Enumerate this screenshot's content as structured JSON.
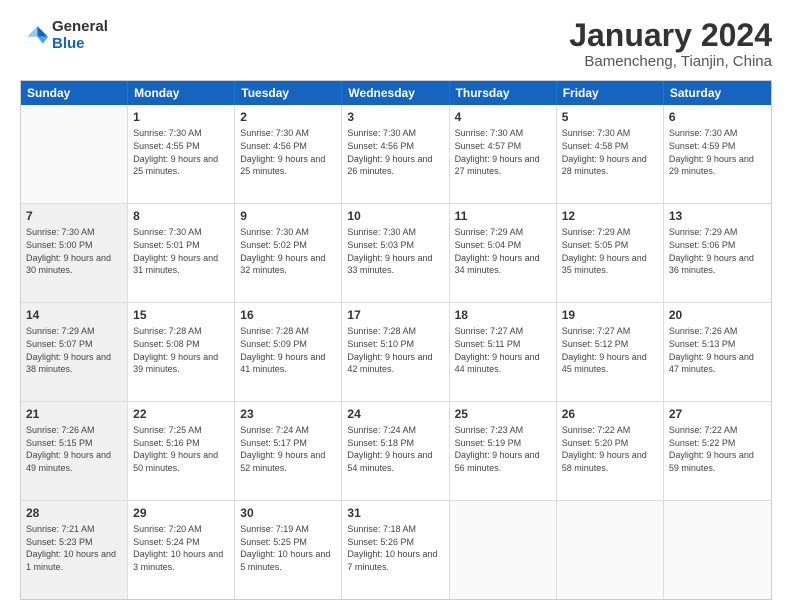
{
  "logo": {
    "line1": "General",
    "line2": "Blue"
  },
  "title": "January 2024",
  "location": "Bamencheng, Tianjin, China",
  "header_days": [
    "Sunday",
    "Monday",
    "Tuesday",
    "Wednesday",
    "Thursday",
    "Friday",
    "Saturday"
  ],
  "weeks": [
    [
      {
        "day": "",
        "sunrise": "",
        "sunset": "",
        "daylight": "",
        "shaded": true
      },
      {
        "day": "1",
        "sunrise": "Sunrise: 7:30 AM",
        "sunset": "Sunset: 4:55 PM",
        "daylight": "Daylight: 9 hours and 25 minutes.",
        "shaded": false
      },
      {
        "day": "2",
        "sunrise": "Sunrise: 7:30 AM",
        "sunset": "Sunset: 4:56 PM",
        "daylight": "Daylight: 9 hours and 25 minutes.",
        "shaded": false
      },
      {
        "day": "3",
        "sunrise": "Sunrise: 7:30 AM",
        "sunset": "Sunset: 4:56 PM",
        "daylight": "Daylight: 9 hours and 26 minutes.",
        "shaded": false
      },
      {
        "day": "4",
        "sunrise": "Sunrise: 7:30 AM",
        "sunset": "Sunset: 4:57 PM",
        "daylight": "Daylight: 9 hours and 27 minutes.",
        "shaded": false
      },
      {
        "day": "5",
        "sunrise": "Sunrise: 7:30 AM",
        "sunset": "Sunset: 4:58 PM",
        "daylight": "Daylight: 9 hours and 28 minutes.",
        "shaded": false
      },
      {
        "day": "6",
        "sunrise": "Sunrise: 7:30 AM",
        "sunset": "Sunset: 4:59 PM",
        "daylight": "Daylight: 9 hours and 29 minutes.",
        "shaded": false
      }
    ],
    [
      {
        "day": "7",
        "sunrise": "Sunrise: 7:30 AM",
        "sunset": "Sunset: 5:00 PM",
        "daylight": "Daylight: 9 hours and 30 minutes.",
        "shaded": true
      },
      {
        "day": "8",
        "sunrise": "Sunrise: 7:30 AM",
        "sunset": "Sunset: 5:01 PM",
        "daylight": "Daylight: 9 hours and 31 minutes.",
        "shaded": false
      },
      {
        "day": "9",
        "sunrise": "Sunrise: 7:30 AM",
        "sunset": "Sunset: 5:02 PM",
        "daylight": "Daylight: 9 hours and 32 minutes.",
        "shaded": false
      },
      {
        "day": "10",
        "sunrise": "Sunrise: 7:30 AM",
        "sunset": "Sunset: 5:03 PM",
        "daylight": "Daylight: 9 hours and 33 minutes.",
        "shaded": false
      },
      {
        "day": "11",
        "sunrise": "Sunrise: 7:29 AM",
        "sunset": "Sunset: 5:04 PM",
        "daylight": "Daylight: 9 hours and 34 minutes.",
        "shaded": false
      },
      {
        "day": "12",
        "sunrise": "Sunrise: 7:29 AM",
        "sunset": "Sunset: 5:05 PM",
        "daylight": "Daylight: 9 hours and 35 minutes.",
        "shaded": false
      },
      {
        "day": "13",
        "sunrise": "Sunrise: 7:29 AM",
        "sunset": "Sunset: 5:06 PM",
        "daylight": "Daylight: 9 hours and 36 minutes.",
        "shaded": false
      }
    ],
    [
      {
        "day": "14",
        "sunrise": "Sunrise: 7:29 AM",
        "sunset": "Sunset: 5:07 PM",
        "daylight": "Daylight: 9 hours and 38 minutes.",
        "shaded": true
      },
      {
        "day": "15",
        "sunrise": "Sunrise: 7:28 AM",
        "sunset": "Sunset: 5:08 PM",
        "daylight": "Daylight: 9 hours and 39 minutes.",
        "shaded": false
      },
      {
        "day": "16",
        "sunrise": "Sunrise: 7:28 AM",
        "sunset": "Sunset: 5:09 PM",
        "daylight": "Daylight: 9 hours and 41 minutes.",
        "shaded": false
      },
      {
        "day": "17",
        "sunrise": "Sunrise: 7:28 AM",
        "sunset": "Sunset: 5:10 PM",
        "daylight": "Daylight: 9 hours and 42 minutes.",
        "shaded": false
      },
      {
        "day": "18",
        "sunrise": "Sunrise: 7:27 AM",
        "sunset": "Sunset: 5:11 PM",
        "daylight": "Daylight: 9 hours and 44 minutes.",
        "shaded": false
      },
      {
        "day": "19",
        "sunrise": "Sunrise: 7:27 AM",
        "sunset": "Sunset: 5:12 PM",
        "daylight": "Daylight: 9 hours and 45 minutes.",
        "shaded": false
      },
      {
        "day": "20",
        "sunrise": "Sunrise: 7:26 AM",
        "sunset": "Sunset: 5:13 PM",
        "daylight": "Daylight: 9 hours and 47 minutes.",
        "shaded": false
      }
    ],
    [
      {
        "day": "21",
        "sunrise": "Sunrise: 7:26 AM",
        "sunset": "Sunset: 5:15 PM",
        "daylight": "Daylight: 9 hours and 49 minutes.",
        "shaded": true
      },
      {
        "day": "22",
        "sunrise": "Sunrise: 7:25 AM",
        "sunset": "Sunset: 5:16 PM",
        "daylight": "Daylight: 9 hours and 50 minutes.",
        "shaded": false
      },
      {
        "day": "23",
        "sunrise": "Sunrise: 7:24 AM",
        "sunset": "Sunset: 5:17 PM",
        "daylight": "Daylight: 9 hours and 52 minutes.",
        "shaded": false
      },
      {
        "day": "24",
        "sunrise": "Sunrise: 7:24 AM",
        "sunset": "Sunset: 5:18 PM",
        "daylight": "Daylight: 9 hours and 54 minutes.",
        "shaded": false
      },
      {
        "day": "25",
        "sunrise": "Sunrise: 7:23 AM",
        "sunset": "Sunset: 5:19 PM",
        "daylight": "Daylight: 9 hours and 56 minutes.",
        "shaded": false
      },
      {
        "day": "26",
        "sunrise": "Sunrise: 7:22 AM",
        "sunset": "Sunset: 5:20 PM",
        "daylight": "Daylight: 9 hours and 58 minutes.",
        "shaded": false
      },
      {
        "day": "27",
        "sunrise": "Sunrise: 7:22 AM",
        "sunset": "Sunset: 5:22 PM",
        "daylight": "Daylight: 9 hours and 59 minutes.",
        "shaded": false
      }
    ],
    [
      {
        "day": "28",
        "sunrise": "Sunrise: 7:21 AM",
        "sunset": "Sunset: 5:23 PM",
        "daylight": "Daylight: 10 hours and 1 minute.",
        "shaded": true
      },
      {
        "day": "29",
        "sunrise": "Sunrise: 7:20 AM",
        "sunset": "Sunset: 5:24 PM",
        "daylight": "Daylight: 10 hours and 3 minutes.",
        "shaded": false
      },
      {
        "day": "30",
        "sunrise": "Sunrise: 7:19 AM",
        "sunset": "Sunset: 5:25 PM",
        "daylight": "Daylight: 10 hours and 5 minutes.",
        "shaded": false
      },
      {
        "day": "31",
        "sunrise": "Sunrise: 7:18 AM",
        "sunset": "Sunset: 5:26 PM",
        "daylight": "Daylight: 10 hours and 7 minutes.",
        "shaded": false
      },
      {
        "day": "",
        "sunrise": "",
        "sunset": "",
        "daylight": "",
        "shaded": false
      },
      {
        "day": "",
        "sunrise": "",
        "sunset": "",
        "daylight": "",
        "shaded": false
      },
      {
        "day": "",
        "sunrise": "",
        "sunset": "",
        "daylight": "",
        "shaded": false
      }
    ]
  ]
}
